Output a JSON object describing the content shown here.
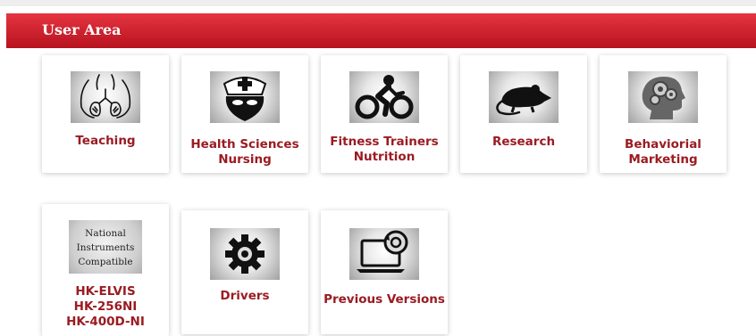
{
  "header": {
    "title": "User Area"
  },
  "cards": [
    {
      "label": "Teaching",
      "icon": "lungs-icon"
    },
    {
      "label": "Health Sciences\nNursing",
      "icon": "nurse-icon"
    },
    {
      "label": "Fitness Trainers\nNutrition",
      "icon": "cyclist-icon"
    },
    {
      "label": "Research",
      "icon": "rat-icon"
    },
    {
      "label": "Behaviorial\nMarketing",
      "icon": "brain-gears-icon"
    },
    {
      "label": "HK-ELVIS\nHK-256NI\nHK-400D-NI",
      "icon": "national-instruments-badge",
      "badge_lines": [
        "National",
        "Instruments",
        "Compatible"
      ]
    },
    {
      "label": "Drivers",
      "icon": "gear-icon"
    },
    {
      "label": "Previous Versions",
      "icon": "laptop-update-icon"
    }
  ]
}
